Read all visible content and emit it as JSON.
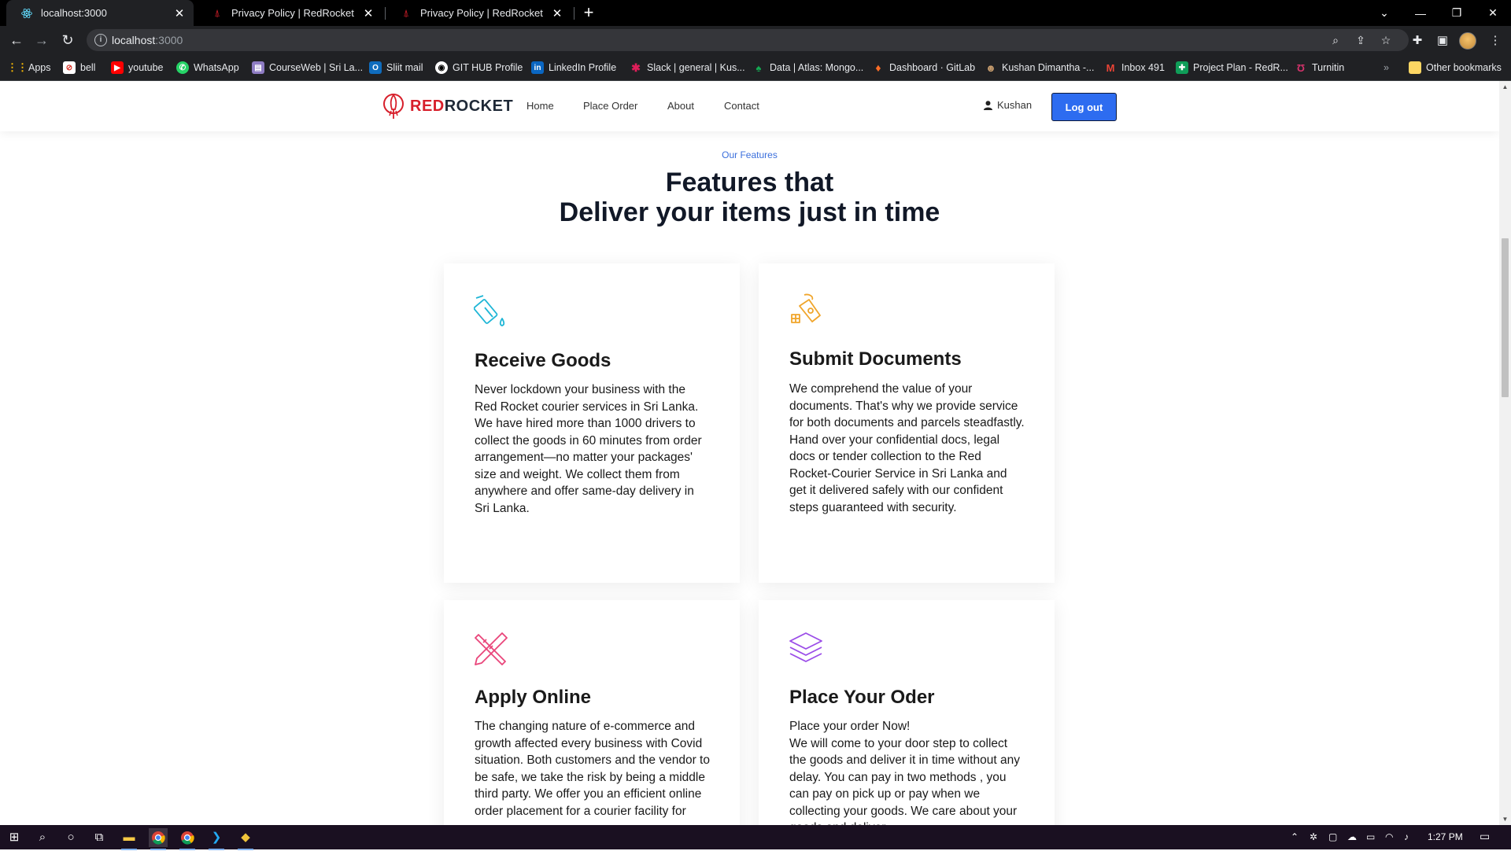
{
  "browser": {
    "tabs": [
      {
        "title": "localhost:3000",
        "favicon": "react-icon",
        "active": true
      },
      {
        "title": "Privacy Policy | RedRocket",
        "favicon": "rocket-icon",
        "active": false
      },
      {
        "title": "Privacy Policy | RedRocket",
        "favicon": "rocket-icon",
        "active": false
      }
    ],
    "url_host": "localhost",
    "url_port": ":3000",
    "bookmarks": [
      {
        "label": "Apps",
        "icon": "apps-grid-icon"
      },
      {
        "label": "bell",
        "icon": "bell-icon"
      },
      {
        "label": "youtube",
        "icon": "youtube-icon"
      },
      {
        "label": "WhatsApp",
        "icon": "whatsapp-icon"
      },
      {
        "label": "CourseWeb | Sri La...",
        "icon": "courseweb-icon"
      },
      {
        "label": "Sliit mail",
        "icon": "outlook-icon"
      },
      {
        "label": "GIT HUB Profile",
        "icon": "github-icon"
      },
      {
        "label": "LinkedIn Profile",
        "icon": "linkedin-icon"
      },
      {
        "label": "Slack | general | Kus...",
        "icon": "slack-icon"
      },
      {
        "label": "Data | Atlas: Mongo...",
        "icon": "mongodb-icon"
      },
      {
        "label": "Dashboard · GitLab",
        "icon": "gitlab-icon"
      },
      {
        "label": "Kushan Dimantha -...",
        "icon": "profile-icon"
      },
      {
        "label": "Inbox 491",
        "icon": "gmail-icon"
      },
      {
        "label": "Project Plan - RedR...",
        "icon": "sheets-icon"
      },
      {
        "label": "Turnitin",
        "icon": "turnitin-icon"
      }
    ],
    "other_bookmarks": "Other bookmarks",
    "bookmarks_overflow": "»"
  },
  "site": {
    "brand_red": "RED",
    "brand_dark": "ROCKET",
    "nav": [
      "Home",
      "Place Order",
      "About",
      "Contact"
    ],
    "user_name": "Kushan",
    "logout_label": "Log out",
    "accent_color": "#2d6cf0",
    "brand_color": "#d71f2b"
  },
  "features": {
    "eyebrow": "Our Features",
    "heading_line1": "Features that",
    "heading_line2": "Deliver your items just in time",
    "cards": [
      {
        "title": "Receive Goods",
        "icon": "paint-bucket-icon",
        "icon_color": "#1fb6d6",
        "text": "Never lockdown your business with the Red Rocket courier services in Sri Lanka. We have hired more than 1000 drivers to collect the goods in 60 minutes from order arrangement—no matter your packages' size and weight. We collect them from anywhere and offer same-day delivery in Sri Lanka."
      },
      {
        "title": "Submit Documents",
        "icon": "pen-tool-icon",
        "icon_color": "#f0a52b",
        "text": "We comprehend the value of your documents. That's why we provide service for both documents and parcels steadfastly. Hand over your confidential docs, legal docs or tender collection to the Red Rocket-Courier Service in Sri Lanka and get it delivered safely with our confident steps guaranteed with security."
      },
      {
        "title": "Apply Online",
        "icon": "pencil-ruler-icon",
        "icon_color": "#e9457a",
        "text": "The changing nature of e-commerce and growth affected every business with Covid situation. Both customers and the vendor to be safe, we take the risk by being a middle third party. We offer you an efficient online order placement for a courier facility for"
      },
      {
        "title": "Place Your Oder",
        "icon": "layers-icon",
        "icon_color": "#9b4de8",
        "text_line1": "Place your order Now!",
        "text": "We will come to your door step to collect the goods and deliver it in time without any delay. You can pay in two methods , you can pay on pick up or pay when we collecting your goods. We care about your goods and deliver"
      }
    ]
  },
  "taskbar": {
    "clock": "1:27 PM",
    "apps": [
      "windows-start-icon",
      "search-icon",
      "cortana-icon",
      "task-view-icon",
      "file-explorer-icon",
      "chrome-icon",
      "chrome-icon",
      "vscode-icon",
      "git-icon"
    ]
  }
}
